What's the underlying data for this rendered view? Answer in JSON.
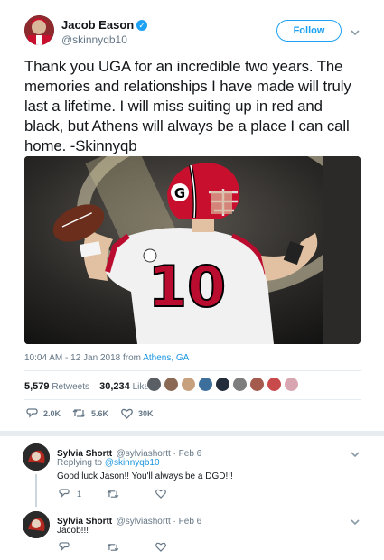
{
  "tweet": {
    "author_name": "Jacob Eason",
    "handle": "@skinnyqb10",
    "follow_label": "Follow",
    "text": "Thank you UGA for an incredible two years. The memories and relationships I have made will truly last a lifetime. I will miss suiting up in red and black, but Athens will always be a place I can call home. -Skinnyqb",
    "timestamp": "10:04 AM - 12 Jan 2018 from ",
    "location": "Athens, GA",
    "retweets_count": "5,579",
    "retweets_label": "Retweets",
    "likes_count": "30,234",
    "likes_label": "Likes",
    "action_reply_count": "2.0K",
    "action_retweet_count": "5.6K",
    "action_like_count": "30K",
    "jersey_number": "10"
  },
  "likers_colors": [
    "#5a5f66",
    "#8a6a55",
    "#c7a07e",
    "#3d6f9c",
    "#222c3a",
    "#7d7d7d",
    "#a55a4e",
    "#c94a4a",
    "#d8a6b0"
  ],
  "replies": [
    {
      "name": "Sylvia Shortt",
      "handle": "@sylviashortt",
      "date": "Feb 6",
      "replying_prefix": "Replying to",
      "replying_to": "@skinnyqb10",
      "text": "Good luck Jason!! You'll always be a DGD!!!",
      "reply_count": "1"
    },
    {
      "name": "Sylvia Shortt",
      "handle": "@sylviashortt",
      "date": "Feb 6",
      "text": "Jacob!!!"
    }
  ],
  "date_separator": " · ",
  "colors": {
    "accent": "#1da1f2",
    "text": "#14171a",
    "muted": "#657786",
    "uga_red": "#ba0c2f"
  }
}
